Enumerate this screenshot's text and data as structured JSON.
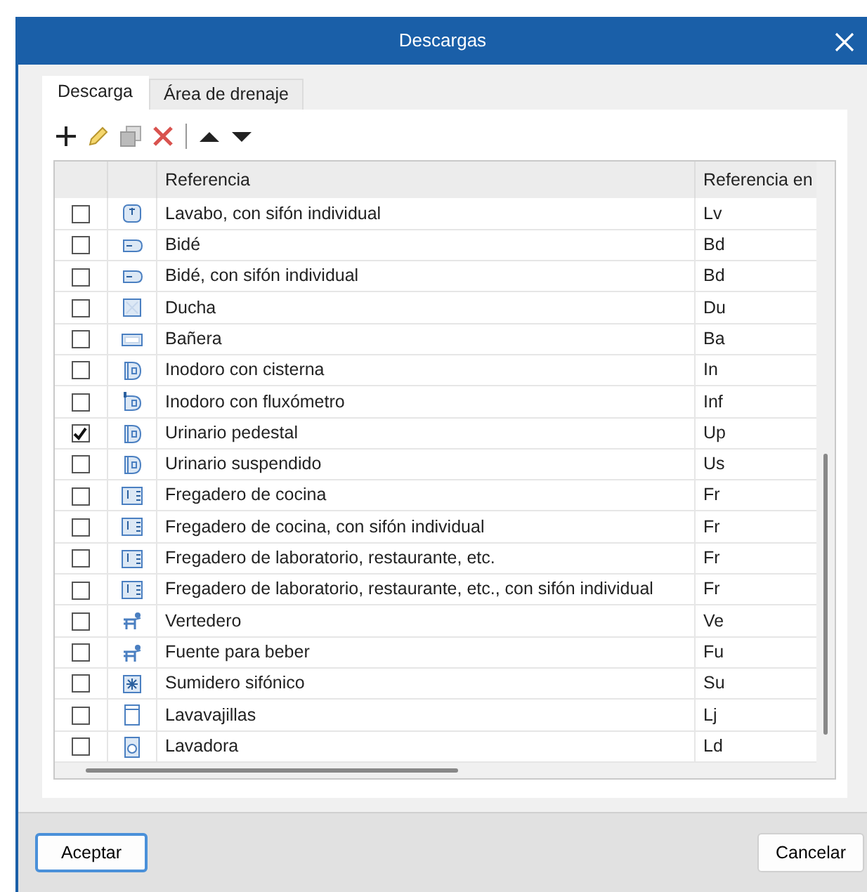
{
  "window": {
    "title": "Descargas"
  },
  "tabs": [
    {
      "label": "Descarga",
      "selected": true
    },
    {
      "label": "Área de drenaje",
      "selected": false
    }
  ],
  "table": {
    "columns": [
      "Referencia",
      "Referencia en"
    ],
    "rows": [
      {
        "checked": false,
        "kind": "basin",
        "name": "Lavabo, con sifón individual",
        "code": "Lv"
      },
      {
        "checked": false,
        "kind": "bidet",
        "name": "Bidé",
        "code": "Bd"
      },
      {
        "checked": false,
        "kind": "bidet",
        "name": "Bidé, con sifón individual",
        "code": "Bd"
      },
      {
        "checked": false,
        "kind": "shower",
        "name": "Ducha",
        "code": "Du"
      },
      {
        "checked": false,
        "kind": "bathtub",
        "name": "Bañera",
        "code": "Ba"
      },
      {
        "checked": false,
        "kind": "toilet",
        "name": "Inodoro con cisterna",
        "code": "In"
      },
      {
        "checked": false,
        "kind": "flushtoilet",
        "name": "Inodoro con fluxómetro",
        "code": "Inf"
      },
      {
        "checked": true,
        "kind": "toilet",
        "name": "Urinario pedestal",
        "code": "Up"
      },
      {
        "checked": false,
        "kind": "toilet",
        "name": "Urinario suspendido",
        "code": "Us"
      },
      {
        "checked": false,
        "kind": "sink",
        "name": "Fregadero de cocina",
        "code": "Fr"
      },
      {
        "checked": false,
        "kind": "sink",
        "name": "Fregadero de cocina, con sifón individual",
        "code": "Fr"
      },
      {
        "checked": false,
        "kind": "sink",
        "name": "Fregadero de laboratorio, restaurante, etc.",
        "code": "Fr"
      },
      {
        "checked": false,
        "kind": "sink",
        "name": "Fregadero de laboratorio, restaurante, etc., con sifón individual",
        "code": "Fr"
      },
      {
        "checked": false,
        "kind": "fountain",
        "name": "Vertedero",
        "code": "Ve"
      },
      {
        "checked": false,
        "kind": "fountain",
        "name": "Fuente para beber",
        "code": "Fu"
      },
      {
        "checked": false,
        "kind": "drain",
        "name": "Sumidero sifónico",
        "code": "Su"
      },
      {
        "checked": false,
        "kind": "dishwasher",
        "name": "Lavavajillas",
        "code": "Lj"
      },
      {
        "checked": false,
        "kind": "washer",
        "name": "Lavadora",
        "code": "Ld"
      }
    ]
  },
  "buttons": [
    {
      "label": "Aceptar",
      "kind": "default"
    },
    {
      "label": "Cancelar",
      "kind": "normal"
    }
  ]
}
